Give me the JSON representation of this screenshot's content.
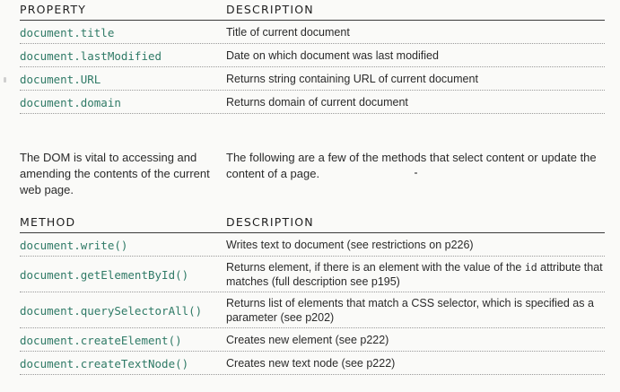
{
  "properties": {
    "header": {
      "col1": "PROPERTY",
      "col2": "DESCRIPTION"
    },
    "rows": [
      {
        "name": "document.title",
        "desc": "Title of current document"
      },
      {
        "name": "document.lastModified",
        "desc": "Date on which document was last modified"
      },
      {
        "name": "document.URL",
        "desc": "Returns string containing URL of current document"
      },
      {
        "name": "document.domain",
        "desc": "Returns domain of current document"
      }
    ]
  },
  "notes": {
    "left": "The DOM is vital to accessing and amending the contents of the current web page.",
    "right": "The following are a few of the methods that select content or update the content of a page."
  },
  "methods": {
    "header": {
      "col1": "METHOD",
      "col2": "DESCRIPTION"
    },
    "rows": [
      {
        "name": "document.write()",
        "desc": "Writes text to document (see restrictions on p226)"
      },
      {
        "name": "document.getElementById()",
        "desc_before": "Returns element, if there is an element with the value of the ",
        "desc_code": "id",
        "desc_after": " attribute that matches (full description see p195)"
      },
      {
        "name": "document.querySelectorAll()",
        "desc": "Returns list of elements that match a CSS selector, which is specified as a parameter (see p202)"
      },
      {
        "name": "document.createElement()",
        "desc": "Creates new element (see p222)"
      },
      {
        "name": "document.createTextNode()",
        "desc": "Creates new text node (see p222)"
      }
    ]
  }
}
